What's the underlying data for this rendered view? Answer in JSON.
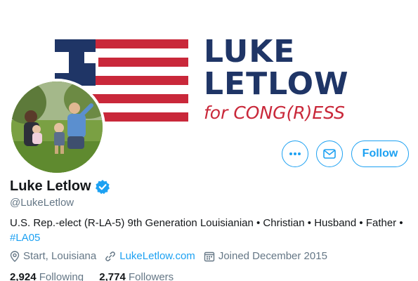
{
  "banner": {
    "name_line1": "LUKE",
    "name_line2": "LETLOW",
    "tagline": "for CONG(R)ESS",
    "colors": {
      "navy": "#1f3566",
      "red": "#c9283a"
    }
  },
  "actions": {
    "more_icon": "more-icon",
    "message_icon": "envelope-icon",
    "follow_label": "Follow"
  },
  "profile": {
    "display_name": "Luke Letlow",
    "verified_icon": "verified-badge-icon",
    "handle": "@LukeLetlow",
    "bio_text": "U.S. Rep.-elect (R-LA-5) 9th Generation Louisianian • Christian • Husband • Father • ",
    "bio_hashtag": "#LA05",
    "location": "Start, Louisiana",
    "website": "LukeLetlow.com",
    "joined": "Joined December 2015"
  },
  "stats": {
    "following_count": "2,924",
    "following_label": "Following",
    "followers_count": "2,774",
    "followers_label": "Followers"
  },
  "theme": {
    "accent": "#1da1f2",
    "secondary_text": "#657786"
  }
}
